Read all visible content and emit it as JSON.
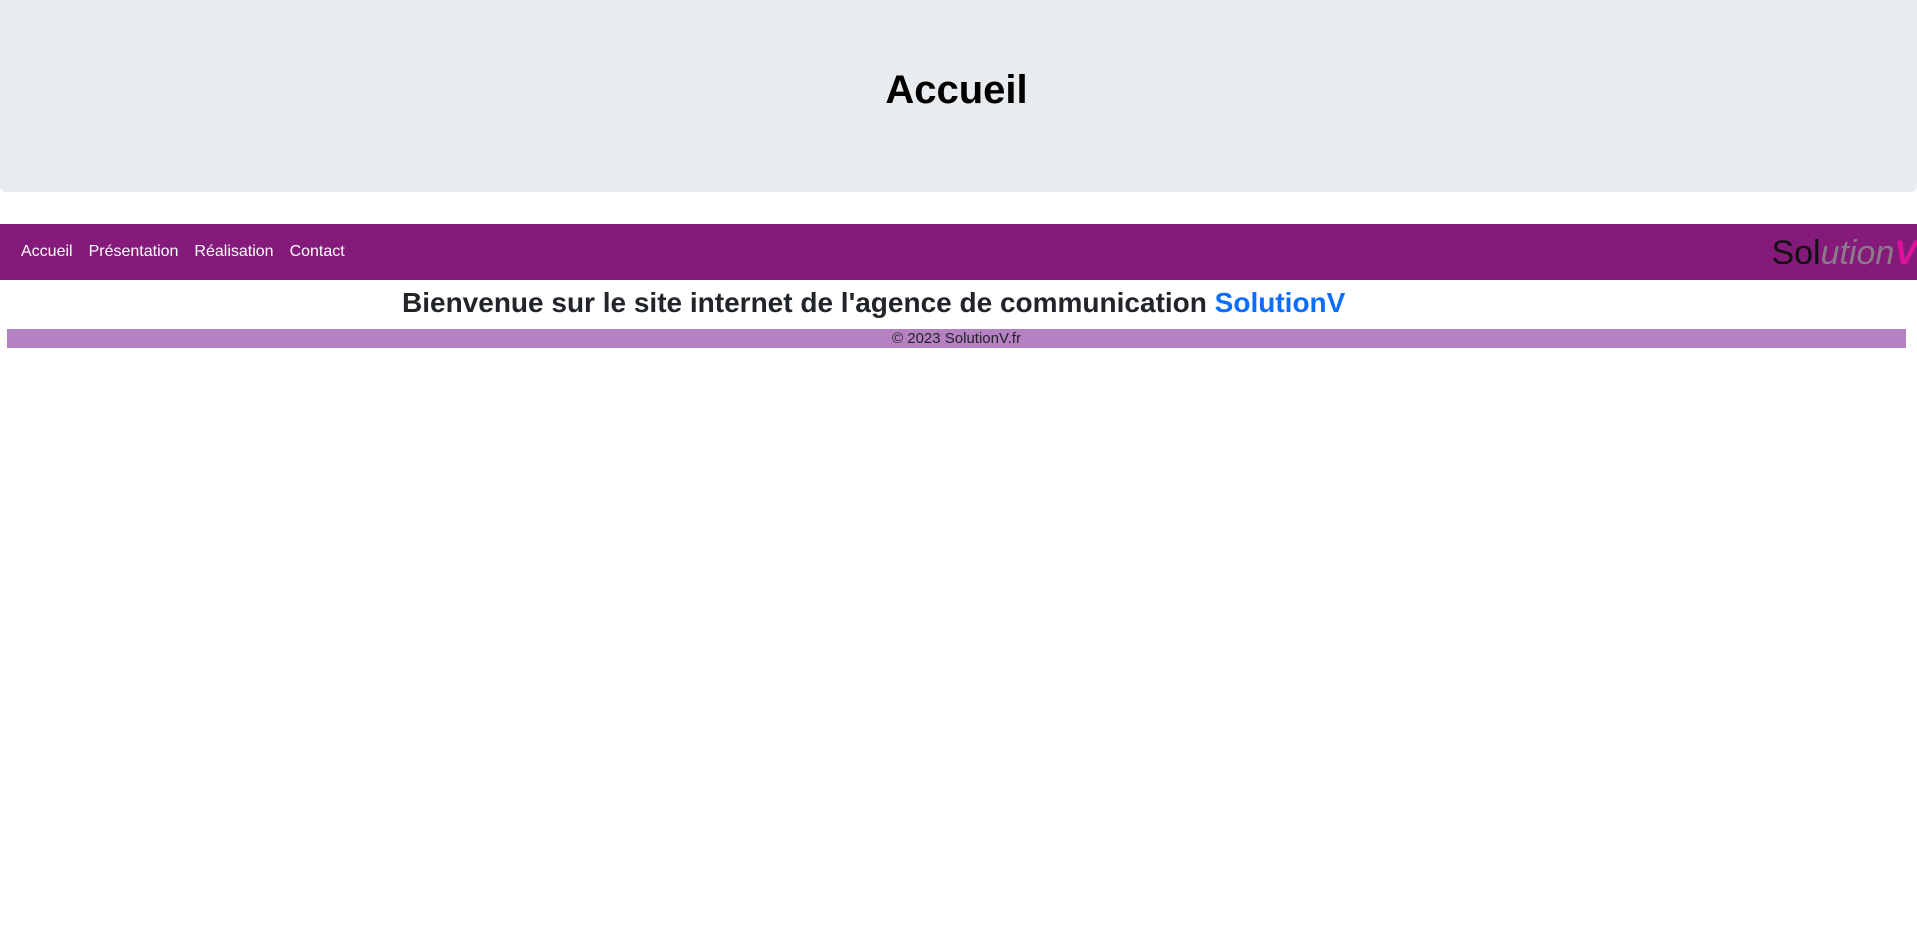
{
  "hero": {
    "title": "Accueil"
  },
  "navbar": {
    "links": [
      {
        "label": "Accueil"
      },
      {
        "label": "Présentation"
      },
      {
        "label": "Réalisation"
      },
      {
        "label": "Contact"
      }
    ],
    "brand": {
      "part1": "Sol",
      "part2": "ution",
      "part3": "V"
    }
  },
  "main": {
    "welcome_text": "Bienvenue sur le site internet de l'agence de communication",
    "welcome_brand": "SolutionV"
  },
  "footer": {
    "text": "© 2023 SolutionV.fr"
  },
  "colors": {
    "hero_bg": "#e9ecef",
    "navbar_bg": "#841b7a",
    "footer_bg": "#b681c2",
    "brand_link": "#0d6efd",
    "brand_accent": "#e0109a"
  }
}
